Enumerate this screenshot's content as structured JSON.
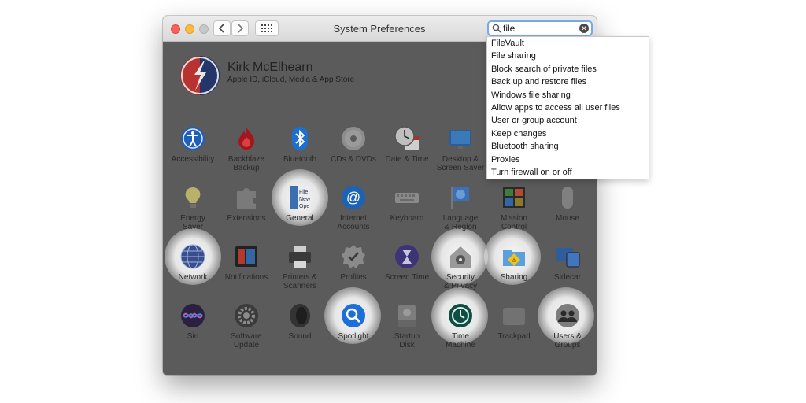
{
  "window": {
    "title": "System Preferences",
    "search": {
      "value": "file"
    }
  },
  "account": {
    "name": "Kirk McElhearn",
    "subtitle": "Apple ID, iCloud, Media & App Store"
  },
  "search_results": [
    "FileVault",
    "File sharing",
    "Block search of private files",
    "Back up and restore files",
    "Windows file sharing",
    "Allow apps to access all user files",
    "User or group account",
    "Keep changes",
    "Bluetooth sharing",
    "Proxies",
    "Turn firewall on or off"
  ],
  "panes": {
    "accessibility": "Accessibility",
    "backblaze": "Backblaze\nBackup",
    "bluetooth": "Bluetooth",
    "cds_dvds": "CDs & DVDs",
    "date_time": "Date & Time",
    "desktop": "Desktop &\nScreen Saver",
    "energy": "Energy\nSaver",
    "extensions": "Extensions",
    "general": "General",
    "internet": "Internet\nAccounts",
    "keyboard": "Keyboard",
    "language": "Language\n& Region",
    "mission": "Mission\nControl",
    "mouse": "Mouse",
    "network": "Network",
    "notifications": "Notifications",
    "printers": "Printers &\nScanners",
    "profiles": "Profiles",
    "screen_time": "Screen Time",
    "security": "Security\n& Privacy",
    "sharing": "Sharing",
    "sidecar": "Sidecar",
    "siri": "Siri",
    "software": "Software\nUpdate",
    "sound": "Sound",
    "spotlight": "Spotlight",
    "startup": "Startup\nDisk",
    "time_machine": "Time\nMachine",
    "trackpad": "Trackpad",
    "users": "Users &\nGroups"
  },
  "icon_names": {
    "accessibility": "accessibility-icon",
    "backblaze": "flame-icon",
    "bluetooth": "bluetooth-icon"
  }
}
